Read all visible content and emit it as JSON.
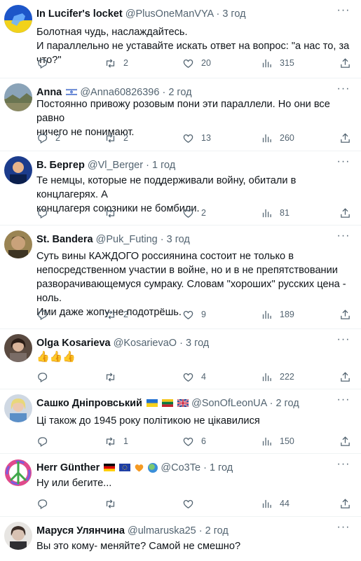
{
  "colors": {
    "text": "#0f1419",
    "secondary": "#536471",
    "divider": "#eff3f4"
  },
  "icons": [
    "reply-icon",
    "retweet-icon",
    "like-icon",
    "views-icon",
    "share-icon",
    "more-icon"
  ],
  "tweets": [
    {
      "name": "In Lucifer's locket",
      "handle": "@PlusOneManVYA",
      "sep": "·",
      "time": "3 год",
      "lines": [
        "Болотная чудь, наслаждайтесь.",
        "И параллельно не уставайте искать ответ на вопрос: \"а нас то, за что?\""
      ],
      "replies": "",
      "retweets": "2",
      "likes": "20",
      "views": "315"
    },
    {
      "name": "Anna",
      "handle": "@Anna60826396",
      "sep": "·",
      "time": "2 год",
      "lines": [
        "Постоянно привожу розовым пони эти параллели. Но они все равно",
        "ничего не понимают."
      ],
      "replies": "2",
      "retweets": "2",
      "likes": "13",
      "views": "260"
    },
    {
      "name": "В. Бергер",
      "handle": "@Vl_Berger",
      "sep": "·",
      "time": "1 год",
      "lines": [
        "Те немцы, которые не поддерживали войну, обитали в концлагерях. А",
        "концлагеря союзники не бомбили."
      ],
      "replies": "",
      "retweets": "",
      "likes": "2",
      "views": "81"
    },
    {
      "name": "St. Bandera",
      "handle": "@Puk_Futing",
      "sep": "·",
      "time": "3 год",
      "lines": [
        "Суть вины КАЖДОГО россиянина состоит не только в",
        "непосредственном участии в войне, но и в не препятствовании",
        "разворачивающемуся сумраку. Словам \"хороших\" русских цена - ноль.",
        "Ими даже жопу не подотрёшь."
      ],
      "replies": "",
      "retweets": "2",
      "likes": "9",
      "views": "189"
    },
    {
      "name": "Olga Kosarieva",
      "handle": "@KosarievaO",
      "sep": "·",
      "time": "3 год",
      "lines": [
        "👍👍👍"
      ],
      "replies": "",
      "retweets": "",
      "likes": "4",
      "views": "222"
    },
    {
      "name": "Сашко Дніпровський",
      "handle": "@SonOfLeonUA",
      "sep": "·",
      "time": "2 год",
      "lines": [
        "Ці також до 1945 року політикою не цікавилися"
      ],
      "replies": "",
      "retweets": "1",
      "likes": "6",
      "views": "150"
    },
    {
      "name": "Herr Günther",
      "handle": "@Co3Te",
      "sep": "·",
      "time": "1 год",
      "lines": [
        "Ну или бегите..."
      ],
      "replies": "",
      "retweets": "",
      "likes": "",
      "views": "44"
    },
    {
      "name": "Маруся Улянчина",
      "handle": "@ulmaruska25",
      "sep": "·",
      "time": "2 год",
      "lines": [
        "Вы это кому- меняйте? Самой не смешно?"
      ],
      "replies": "",
      "retweets": "",
      "likes": "",
      "views": ""
    }
  ]
}
